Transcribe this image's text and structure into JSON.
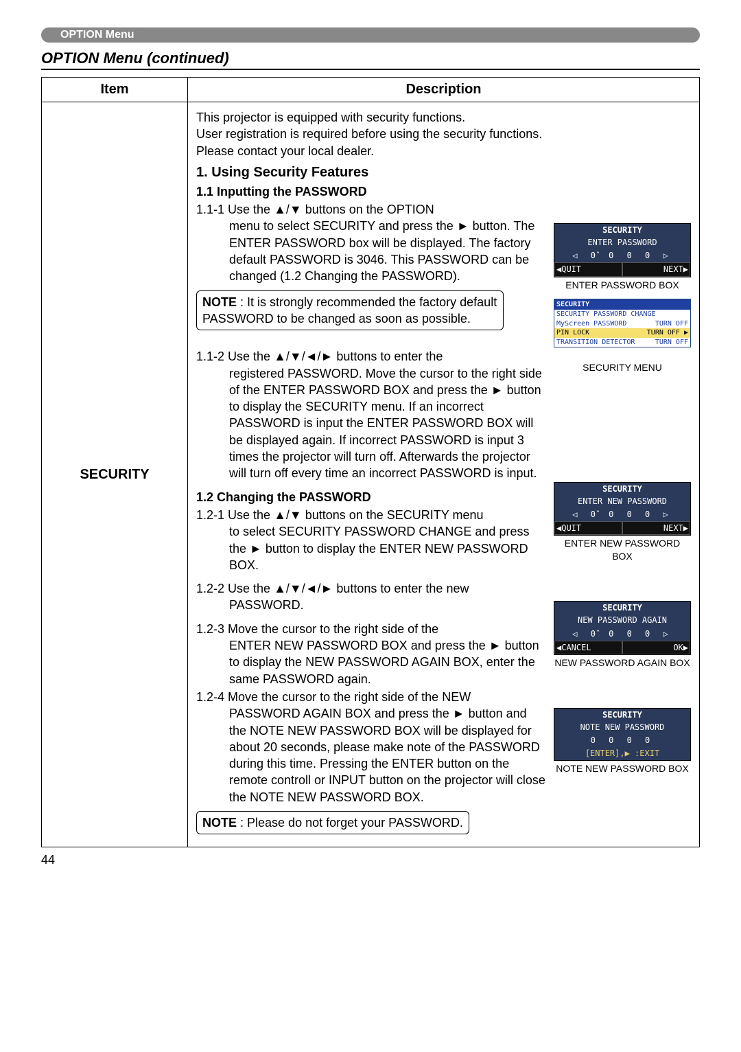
{
  "header_tab": "OPTION Menu",
  "section_title": "OPTION Menu (continued)",
  "table": {
    "col_item": "Item",
    "col_desc": "Description",
    "item_name": "SECURITY"
  },
  "intro": "This projector is equipped with security functions.\nUser registration is required before using the security functions.\nPlease contact your local dealer.",
  "h1": "1. Using Security Features",
  "h2_11": "1.1 Inputting the PASSWORD",
  "s111_head": "1.1-1 Use the ▲/▼ buttons on the OPTION",
  "s111_body": "menu to select SECURITY and press the ► button. The ENTER PASSWORD box will be displayed. The factory default PASSWORD is 3046. This PASSWORD can be changed (1.2 Changing the PASSWORD).",
  "note1_label": "NOTE",
  "note1_text": " : It is strongly recommended the factory default PASSWORD to be changed as soon as possible.",
  "s112_head": "1.1-2 Use the ▲/▼/◄/► buttons to enter the",
  "s112_body": "registered PASSWORD. Move the cursor to the right side of the ENTER PASSWORD BOX and press the ► button to display the SECURITY menu. If an incorrect PASSWORD is input the ENTER PASSWORD BOX will be displayed again. If incorrect PASSWORD is input 3 times the projector will turn off. Afterwards the projector will turn off every time an incorrect PASSWORD is input.",
  "h2_12": "1.2 Changing the PASSWORD",
  "s121_head": "1.2-1 Use the ▲/▼ buttons on the SECURITY menu",
  "s121_body": "to select SECURITY PASSWORD CHANGE and press the ► button to display the ENTER NEW PASSWORD BOX.",
  "s122_head": "1.2-2 Use the ▲/▼/◄/► buttons to enter the new",
  "s122_body": "PASSWORD.",
  "s123_head": "1.2-3 Move the cursor to the right side of the",
  "s123_body": "ENTER NEW PASSWORD BOX and press the ► button to display the NEW PASSWORD AGAIN BOX, enter the same PASSWORD again.",
  "s124_head": "1.2-4 Move the cursor to the right side of the NEW",
  "s124_body": "PASSWORD AGAIN BOX and press the ► button and the NOTE NEW PASSWORD BOX will be displayed for about 20 seconds, please make note of the PASSWORD during this time. Pressing the ENTER button on the remote controll or INPUT button on the projector will close the NOTE NEW PASSWORD BOX.",
  "note2_label": "NOTE",
  "note2_text": " : Please do not forget your PASSWORD.",
  "fig1": {
    "title": "SECURITY",
    "sub": "ENTER PASSWORD",
    "digits": "◁ 0̂  0  0  0 ▷",
    "left": "◀QUIT",
    "right": "NEXT▶",
    "caption": "ENTER PASSWORD BOX"
  },
  "fig2": {
    "title": "SECURITY",
    "rows": [
      {
        "l": "SECURITY PASSWORD CHANGE",
        "r": ""
      },
      {
        "l": "MyScreen PASSWORD",
        "r": "TURN OFF"
      },
      {
        "l": "PIN LOCK",
        "r": "TURN OFF ▶",
        "sel": true
      },
      {
        "l": "TRANSITION DETECTOR",
        "r": "TURN OFF"
      }
    ],
    "caption": "SECURITY MENU"
  },
  "fig3": {
    "title": "SECURITY",
    "sub": "ENTER NEW PASSWORD",
    "digits": "◁ 0̂  0  0  0 ▷",
    "left": "◀QUIT",
    "right": "NEXT▶",
    "caption": "ENTER NEW PASSWORD BOX"
  },
  "fig4": {
    "title": "SECURITY",
    "sub": "NEW PASSWORD AGAIN",
    "digits": "◁ 0̂  0  0  0 ▷",
    "left": "◀CANCEL",
    "right": "OK▶",
    "caption": "NEW PASSWORD AGAIN BOX"
  },
  "fig5": {
    "title": "SECURITY",
    "sub": "NOTE NEW PASSWORD",
    "digits": "0  0  0  0",
    "note": "[ENTER],▶ :EXIT",
    "caption": "NOTE NEW PASSWORD BOX"
  },
  "page_number": "44"
}
